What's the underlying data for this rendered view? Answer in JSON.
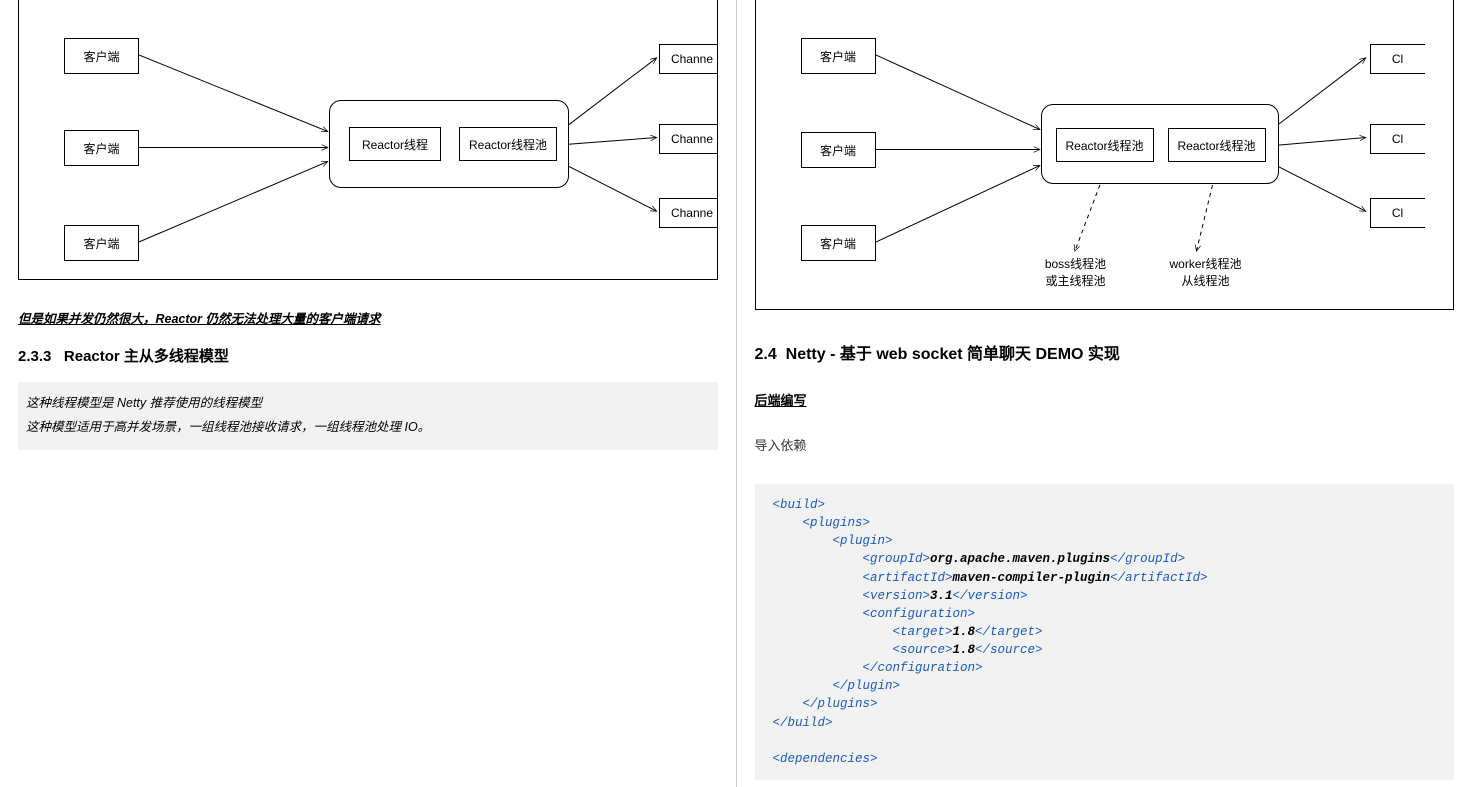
{
  "left": {
    "diagram1": {
      "clients": [
        "客户端",
        "客户端",
        "客户端"
      ],
      "reactor_thread": "Reactor线程",
      "reactor_pool": "Reactor线程池",
      "channels": [
        "Channe",
        "Channe",
        "Channe"
      ]
    },
    "note": "但是如果并发仍然很大，Reactor 仍然无法处理大量的客户端请求",
    "section_num": "2.3.3",
    "section_title": "Reactor 主从多线程模型",
    "quote_line1": "这种线程模型是 Netty 推荐使用的线程模型",
    "quote_line2": "这种模型适用于高并发场景，一组线程池接收请求，一组线程池处理 IO。"
  },
  "right": {
    "diagram2": {
      "clients": [
        "客户端",
        "客户端",
        "客户端"
      ],
      "reactor_pool_a": "Reactor线程池",
      "reactor_pool_b": "Reactor线程池",
      "channels": [
        "Cl",
        "Cl",
        "Cl"
      ],
      "annot_a_l1": "boss线程池",
      "annot_a_l2": "或主线程池",
      "annot_b_l1": "worker线程池",
      "annot_b_l2": "从线程池"
    },
    "section_num": "2.4",
    "section_title": "Netty - 基于 web socket 简单聊天 DEMO 实现",
    "backend_label": "后端编写",
    "import_label": "导入依赖",
    "code": {
      "l1": "<build>",
      "l2": "    <plugins>",
      "l3": "        <plugin>",
      "l4a": "            <groupId>",
      "l4b": "org.apache.maven.plugins",
      "l4c": "</groupId>",
      "l5a": "            <artifactId>",
      "l5b": "maven-compiler-plugin",
      "l5c": "</artifactId>",
      "l6a": "            <version>",
      "l6b": "3.1",
      "l6c": "</version>",
      "l7": "            <configuration>",
      "l8a": "                <target>",
      "l8b": "1.8",
      "l8c": "</target>",
      "l9a": "                <source>",
      "l9b": "1.8",
      "l9c": "</source>",
      "l10": "            </configuration>",
      "l11": "        </plugin>",
      "l12": "    </plugins>",
      "l13": "</build>",
      "l14": "",
      "l15": "<dependencies>"
    }
  }
}
